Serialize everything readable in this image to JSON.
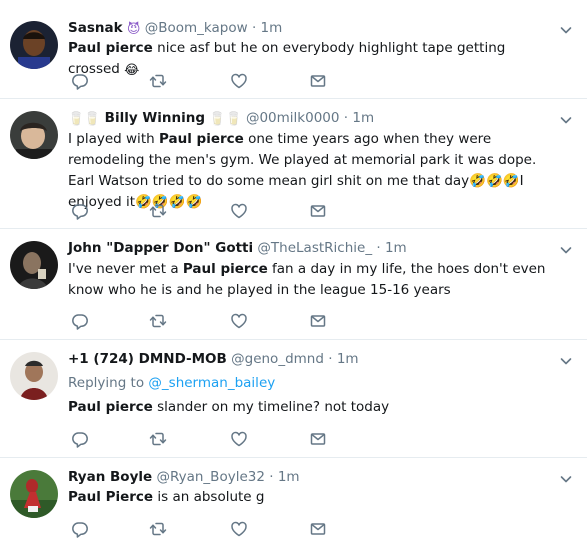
{
  "tweets": [
    {
      "name": "Sasnak",
      "name_emoji": "😈",
      "handle": "@Boom_kapow",
      "dot": "·",
      "time": "1m",
      "body_bold": "Paul pierce",
      "body_rest": " nice asf but he on everybody highlight tape getting crossed ",
      "body_emoji": "😂"
    },
    {
      "name_prefix_emoji": "🥛🥛",
      "name": "Billy Winning",
      "name_suffix_emoji": "🥛🥛",
      "handle": "@00milk0000",
      "dot": "·",
      "time": "1m",
      "body_pre": "I played with ",
      "body_bold": "Paul pierce",
      "body_rest_1": " one time years ago when they were remodeling the men's gym. We played at memorial park it was dope. Earl Watson tried to do some mean girl shit on me that day",
      "body_emoji_1": "🤣🤣🤣",
      "body_rest_2": "I enjoyed it",
      "body_emoji_2": "🤣🤣🤣🤣"
    },
    {
      "name": "John \"Dapper Don\" Gotti",
      "handle": "@TheLastRichie_",
      "dot": "·",
      "time": "1m",
      "body_pre": "I've never met a ",
      "body_bold": "Paul pierce",
      "body_rest": " fan a day in my life, the hoes don't even know who he is and he played in the league 15-16 years"
    },
    {
      "name": "+1 (724) DMND-MOB",
      "handle": "@geno_dmnd",
      "dot": "·",
      "time": "1m",
      "replying_label": "Replying to ",
      "replying_handle": "@_sherman_bailey",
      "body_bold": "Paul pierce",
      "body_rest": " slander on my timeline? not today"
    },
    {
      "name": "Ryan Boyle",
      "handle": "@Ryan_Boyle32",
      "dot": "·",
      "time": "1m",
      "body_bold": "Paul Pierce",
      "body_rest": " is an absolute g"
    }
  ],
  "icons": {
    "reply": "reply-icon",
    "retweet": "retweet-icon",
    "like": "heart-icon",
    "dm": "envelope-icon",
    "menu": "chevron-down-icon"
  },
  "colors": {
    "name": "#14171a",
    "meta": "#657786",
    "link": "#1da1f2",
    "icon": "#657786",
    "divider": "#e6ecf0",
    "emoji_purple": "#8b5cc8",
    "emoji_yellow": "#f7c548"
  }
}
